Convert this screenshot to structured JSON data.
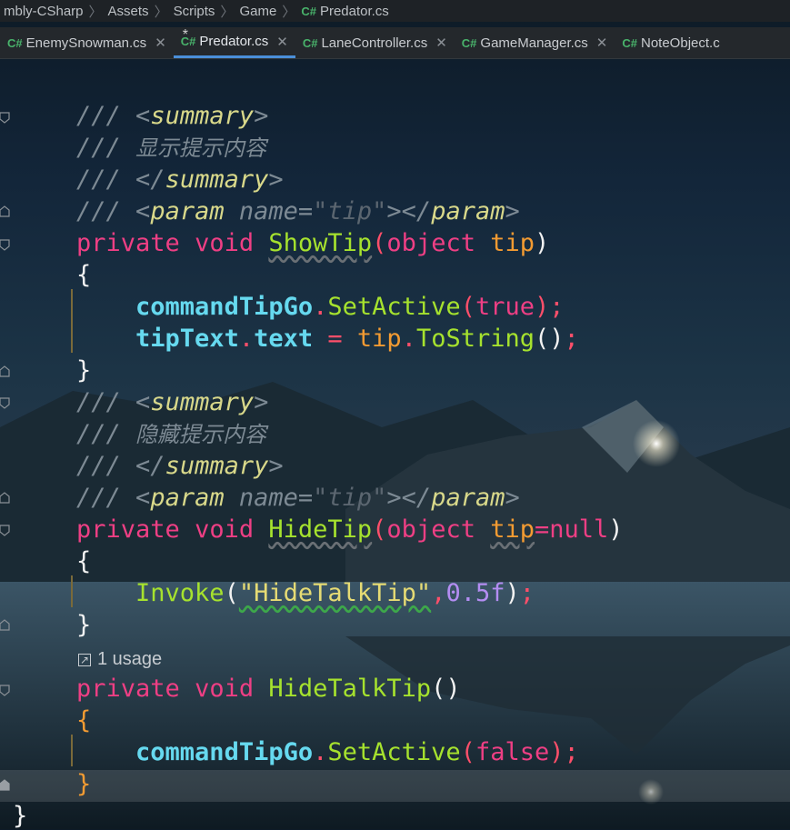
{
  "breadcrumb": {
    "items": [
      "mbly-CSharp",
      "Assets",
      "Scripts",
      "Game",
      "Predator.cs"
    ]
  },
  "tabs": [
    {
      "label": "EnemySnowman.cs",
      "icon": "C#",
      "active": false,
      "modified": false
    },
    {
      "label": "Predator.cs",
      "icon": "C#",
      "active": true,
      "modified": true
    },
    {
      "label": "LaneController.cs",
      "icon": "C#",
      "active": false,
      "modified": false
    },
    {
      "label": "GameManager.cs",
      "icon": "C#",
      "active": false,
      "modified": false
    },
    {
      "label": "NoteObject.c",
      "icon": "C#",
      "active": false,
      "modified": false
    }
  ],
  "code": {
    "summary_open": "<summary>",
    "summary_close": "</summary>",
    "doc_prefix": "///",
    "show_desc": "显示提示内容",
    "hide_desc": "隐藏提示内容",
    "param_open": "<param",
    "param_name_attr": "name=",
    "param_name_value": "\"tip\"",
    "param_tail": "></param>",
    "kw_private": "private",
    "kw_void": "void",
    "show_method": "ShowTip",
    "hide_method": "HideTip",
    "talk_method": "HideTalkTip",
    "kw_object": "object",
    "param_tip": "tip",
    "param_default": "=null",
    "field_go": "commandTipGo",
    "set_active": "SetActive",
    "kw_true": "true",
    "kw_false": "false",
    "field_text": "tipText",
    "prop_text": "text",
    "to_string": "ToString",
    "invoke": "Invoke",
    "invoke_str": "\"HideTalkTip\"",
    "invoke_num": "0.5f",
    "usage_text": "1 usage"
  },
  "colors": {
    "keyword": "#ee3f84",
    "method": "#a6e22e",
    "field": "#66d9ef",
    "parameter": "#f39b32",
    "comment": "#7d8a94",
    "tab_accent": "#4a8fd9"
  }
}
